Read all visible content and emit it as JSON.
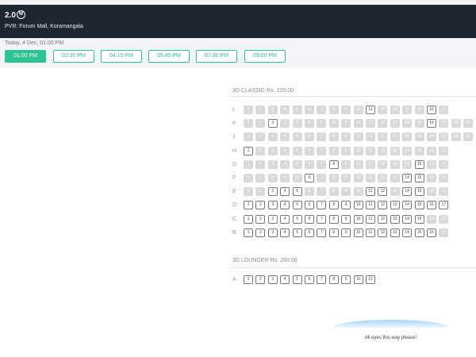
{
  "movie": {
    "title": "2.0",
    "certificate": "U/A",
    "venue": "PVR: Forum Mall, Koramangala"
  },
  "show": {
    "date_label": "Today, 4 Dec, 01:00 PM",
    "times": [
      "01:00 PM",
      "02:30 PM",
      "04:15 PM",
      "05:45 PM",
      "07:30 PM",
      "09:00 PM"
    ],
    "selected_index": 0
  },
  "sections": [
    {
      "title": "3D CLASSIC-Rs. 220.00",
      "rows": [
        {
          "letter": "L",
          "count": 17,
          "available": [
            11,
            16
          ]
        },
        {
          "letter": "K",
          "count": 19,
          "available": [
            3,
            16
          ]
        },
        {
          "letter": "J",
          "count": 19,
          "available": []
        },
        {
          "letter": "H",
          "count": 17,
          "available": [
            1
          ]
        },
        {
          "letter": "G",
          "count": 17,
          "available": [
            8,
            15
          ]
        },
        {
          "letter": "F",
          "count": 17,
          "available": [
            6,
            14,
            15
          ]
        },
        {
          "letter": "E",
          "count": 17,
          "available": [
            3,
            4,
            5,
            11,
            12,
            14,
            15
          ]
        },
        {
          "letter": "D",
          "count": 17,
          "available": [
            1,
            2,
            3,
            4,
            5,
            6,
            7,
            8,
            9,
            10,
            11,
            12,
            13,
            14,
            15,
            16,
            17
          ]
        },
        {
          "letter": "C",
          "count": 17,
          "available": [
            1,
            2,
            3,
            4,
            5,
            6,
            7,
            8,
            9,
            10,
            11,
            12,
            13,
            14,
            15
          ]
        },
        {
          "letter": "B",
          "count": 17,
          "available": [
            1,
            2,
            3,
            4,
            5,
            6,
            7,
            8,
            9,
            10,
            11,
            12,
            13,
            14,
            15,
            16
          ]
        }
      ]
    },
    {
      "title": "3D LOUNGER-Rs. 260.00",
      "rows": [
        {
          "letter": "A",
          "count": 11,
          "available": [
            1,
            2,
            3,
            4,
            5,
            6,
            7,
            8,
            9,
            10,
            11
          ]
        }
      ]
    }
  ],
  "screen": {
    "label": "All eyes this way please!"
  },
  "colors": {
    "header_bg": "#1f2533",
    "accent": "#2dc492",
    "sold_seat": "#d9d9d9"
  }
}
